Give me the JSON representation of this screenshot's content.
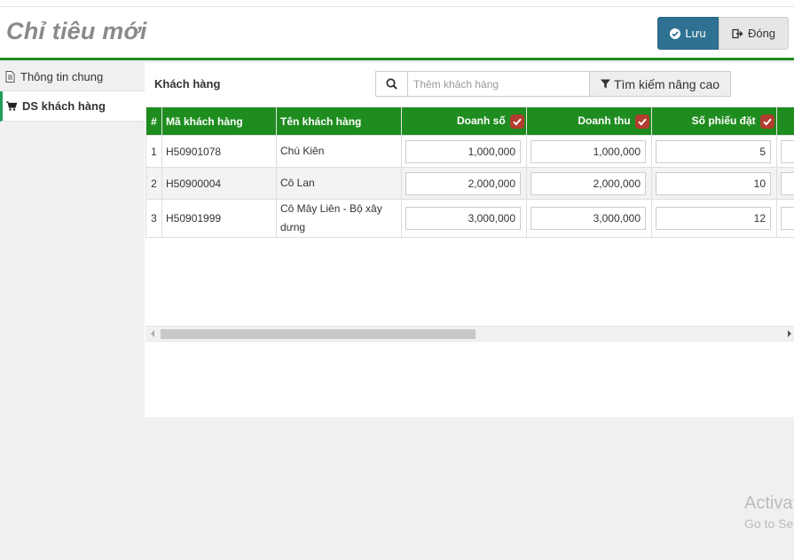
{
  "header": {
    "title": "Chỉ tiêu mới",
    "save_label": "Lưu",
    "close_label": "Đóng"
  },
  "sidebar": {
    "items": [
      {
        "label": "Thông tin chung",
        "icon": "document-icon",
        "active": false
      },
      {
        "label": "DS khách hàng",
        "icon": "cart-icon",
        "active": true
      }
    ]
  },
  "customers": {
    "section_label": "Khách hàng",
    "search_placeholder": "Thêm khách hàng",
    "advanced_search_label": "Tìm kiếm nâng cao"
  },
  "table": {
    "columns": {
      "index": "#",
      "code": "Mã khách hàng",
      "name": "Tên khách hàng",
      "sales": "Doanh số",
      "revenue": "Doanh thu",
      "orders": "Số phiếu đặt"
    },
    "rows": [
      {
        "index": "1",
        "code": "H50901078",
        "name": "Chú Kiên",
        "sales": "1,000,000",
        "revenue": "1,000,000",
        "orders": "5"
      },
      {
        "index": "2",
        "code": "H50900004",
        "name": "Cô Lan",
        "sales": "2,000,000",
        "revenue": "2,000,000",
        "orders": "10"
      },
      {
        "index": "3",
        "code": "H50901999",
        "name": "Cô Mây Liên - Bộ xây dưng",
        "sales": "3,000,000",
        "revenue": "3,000,000",
        "orders": "12"
      }
    ]
  },
  "watermark": {
    "title": "Activat",
    "subtitle": "Go to Se"
  },
  "colors": {
    "accent_green": "#1f8c1f",
    "save_blue": "#2e7192",
    "check_red": "#b23c2f"
  }
}
